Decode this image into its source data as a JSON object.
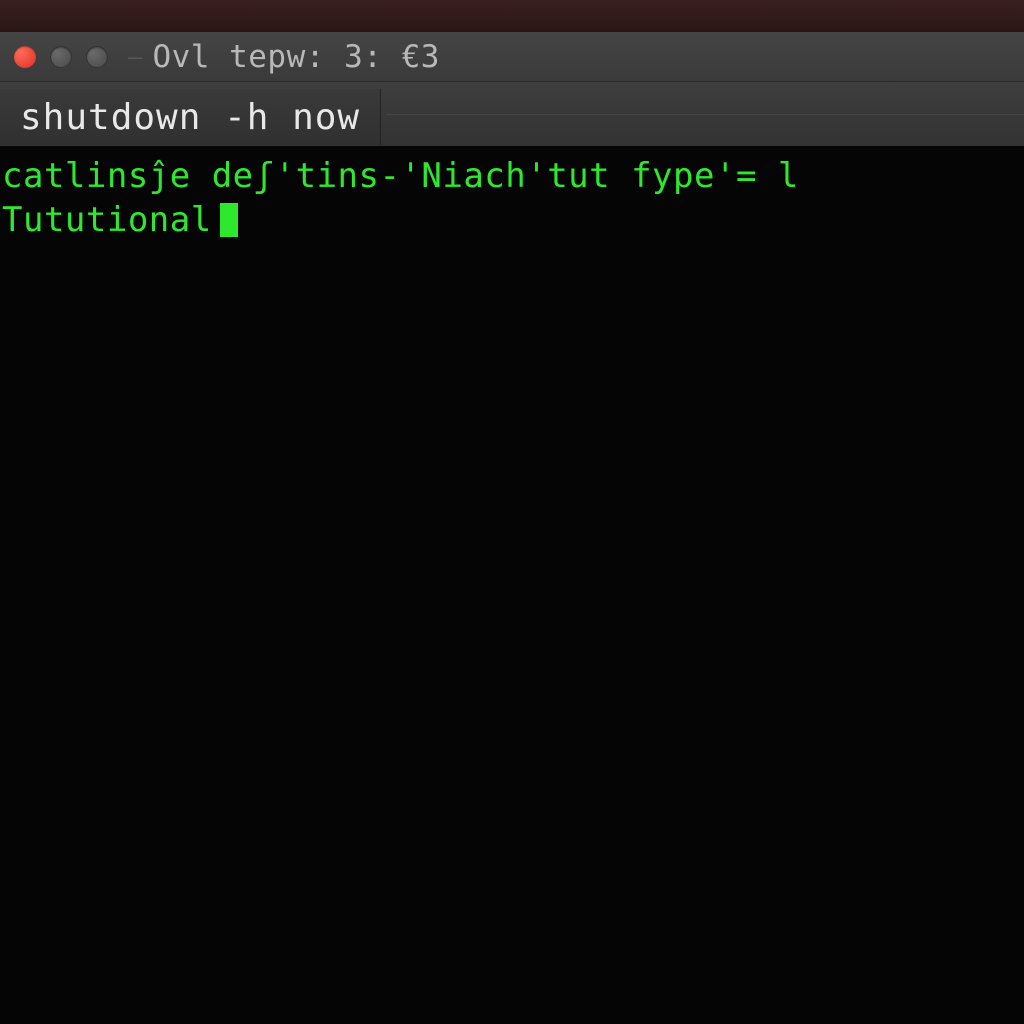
{
  "titlebar": {
    "title": "Ovl tepw: 3: €3"
  },
  "tabs": {
    "active_label": "shutdown -h now"
  },
  "terminal": {
    "line1": "catlinsĵe deʃ'tins-'Niach'tut fype'= l",
    "line2": "Tututional"
  },
  "colors": {
    "terminal_fg": "#2ee82e",
    "terminal_bg": "#050505",
    "titlebar_bg": "#3a3a3a",
    "close_button": "#dd3020"
  }
}
